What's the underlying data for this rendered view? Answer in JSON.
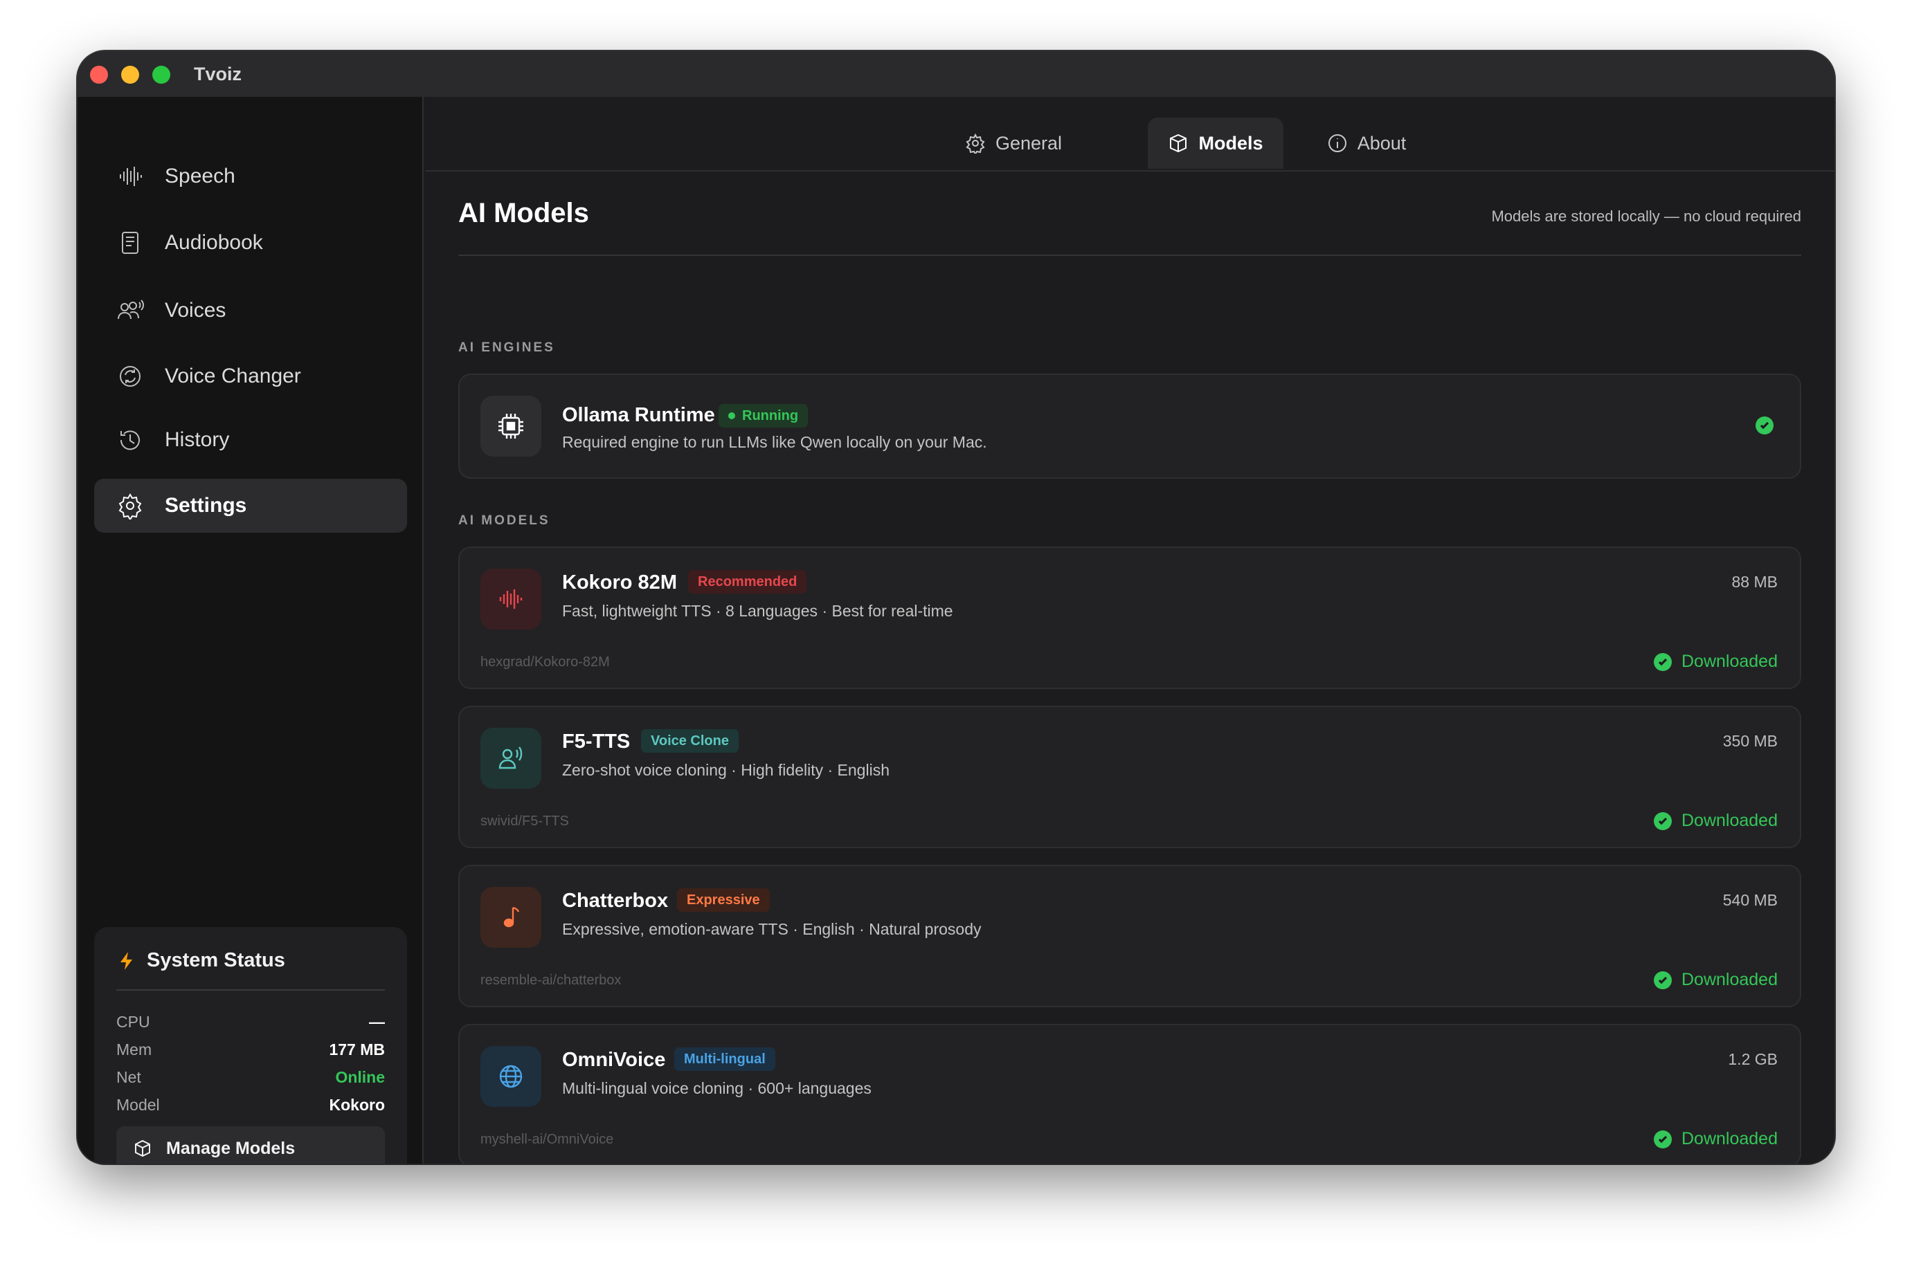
{
  "window": {
    "title": "Tvoiz"
  },
  "sidebar": {
    "items": [
      {
        "label": "Speech",
        "icon": "waveform-icon"
      },
      {
        "label": "Audiobook",
        "icon": "book-icon"
      },
      {
        "label": "Voices",
        "icon": "voices-icon"
      },
      {
        "label": "Voice Changer",
        "icon": "voice-changer-icon"
      },
      {
        "label": "History",
        "icon": "history-icon"
      },
      {
        "label": "Settings",
        "icon": "gear-icon",
        "active": true
      }
    ],
    "status": {
      "title": "System Status",
      "rows": [
        {
          "key": "CPU",
          "value": "—"
        },
        {
          "key": "Mem",
          "value": "177 MB"
        },
        {
          "key": "Net",
          "value": "Online"
        },
        {
          "key": "Model",
          "value": "Kokoro"
        }
      ],
      "manage_label": "Manage Models"
    }
  },
  "tabs": [
    {
      "label": "General",
      "icon": "gear-icon"
    },
    {
      "label": "Models",
      "icon": "cube-icon",
      "active": true
    },
    {
      "label": "About",
      "icon": "info-icon"
    }
  ],
  "page": {
    "title": "AI Models",
    "note": "Models are stored locally — no cloud required",
    "engines_label": "AI ENGINES",
    "models_label": "AI MODELS"
  },
  "engine": {
    "name": "Ollama Runtime",
    "badge": "Running",
    "desc": "Required engine to run LLMs like Qwen locally on your Mac.",
    "icon": "chip-icon"
  },
  "models": [
    {
      "name": "Kokoro 82M",
      "badge": "Recommended",
      "desc": "Fast, lightweight TTS · 8 Languages · Best for real-time",
      "repo": "hexgrad/Kokoro-82M",
      "size": "88 MB",
      "status": "Downloaded",
      "icon": "waveform-icon",
      "accent": "#e5484d"
    },
    {
      "name": "F5-TTS",
      "badge": "Voice Clone",
      "desc": "Zero-shot voice cloning · High fidelity · English",
      "repo": "swivid/F5-TTS",
      "size": "350 MB",
      "status": "Downloaded",
      "icon": "voice-clone-icon",
      "accent": "#5ec8c0"
    },
    {
      "name": "Chatterbox",
      "badge": "Expressive",
      "desc": "Expressive, emotion-aware TTS · English · Natural prosody",
      "repo": "resemble-ai/chatterbox",
      "size": "540 MB",
      "status": "Downloaded",
      "icon": "music-note-icon",
      "accent": "#ff7a45"
    },
    {
      "name": "OmniVoice",
      "badge": "Multi-lingual",
      "desc": "Multi-lingual voice cloning · 600+ languages",
      "repo": "myshell-ai/OmniVoice",
      "size": "1.2 GB",
      "status": "Downloaded",
      "icon": "globe-icon",
      "accent": "#4aa3e6"
    }
  ],
  "colors": {
    "accent_green": "#34c759",
    "background": "#1c1c1e",
    "sidebar": "#141414"
  }
}
